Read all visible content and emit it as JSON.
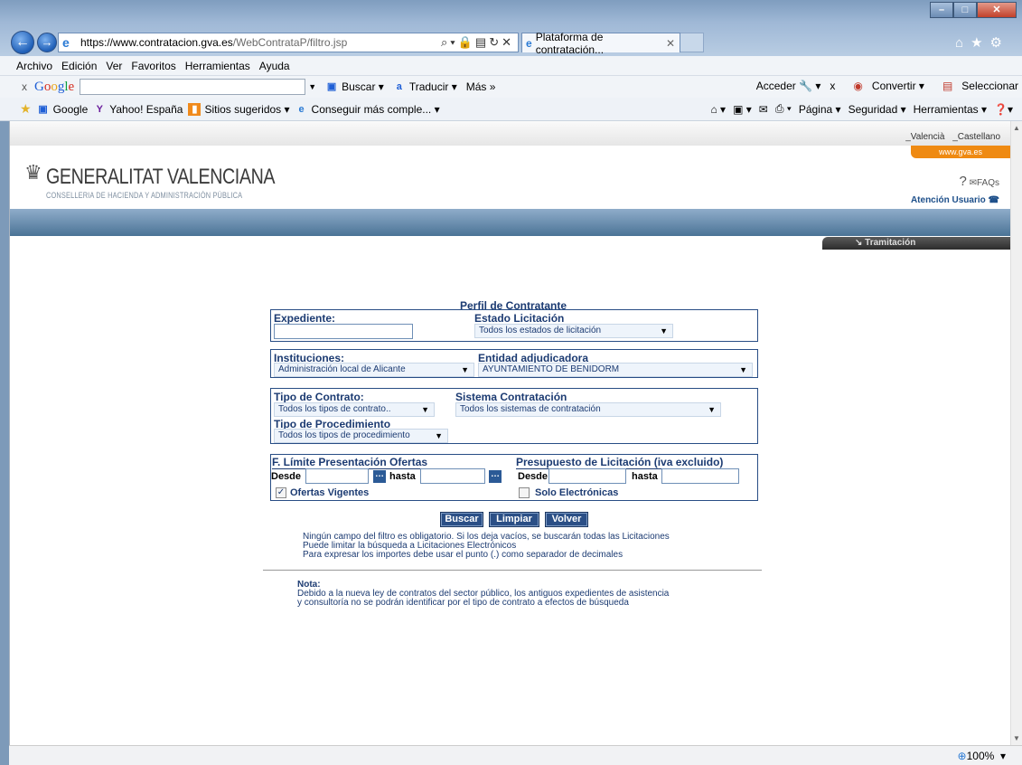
{
  "browser": {
    "url_host": "https://www.contratacion.gva.es",
    "url_path": "/WebContrataP/filtro.jsp",
    "tab_title": "Plataforma de contratación...",
    "menu": [
      "Archivo",
      "Edición",
      "Ver",
      "Favoritos",
      "Herramientas",
      "Ayuda"
    ],
    "google_bar": {
      "logo": "Google",
      "search_label": "Buscar",
      "translate_label": "Traducir",
      "more_label": "Más »",
      "signin_label": "Acceder",
      "convert_label": "Convertir",
      "select_label": "Seleccionar"
    },
    "favorites": {
      "items": [
        "Google",
        "Yahoo! España",
        "Sitios sugeridos ▾",
        "Conseguir más comple... ▾"
      ],
      "right": [
        "Página ▾",
        "Seguridad ▾",
        "Herramientas ▾"
      ]
    },
    "zoom": "100%"
  },
  "page_header": {
    "lang_valencia": "_Valencià",
    "lang_castellano": "_Castellano",
    "gva_link": "www.gva.es",
    "logo_title": "GENERALITAT VALENCIANA",
    "logo_subtitle": "CONSELLERIA DE HACIENDA Y ADMINISTRACIÓN PÚBLICA",
    "faqs": "FAQs",
    "atencion": "Atención Usuario",
    "tramitacion": "Tramitación"
  },
  "form": {
    "title": "Perfil de Contratante",
    "expediente_label": "Expediente:",
    "expediente_value": "",
    "estado_label": "Estado Licitación",
    "estado_value": "Todos los estados de licitación",
    "instituciones_label": "Instituciones:",
    "instituciones_value": "Administración local de Alicante",
    "entidad_label": "Entidad adjudicadora",
    "entidad_value": "AYUNTAMIENTO DE BENIDORM",
    "tipo_contrato_label": "Tipo de Contrato:",
    "tipo_contrato_value": "Todos los tipos de contrato..",
    "sistema_label": "Sistema Contratación",
    "sistema_value": "Todos los sistemas de contratación",
    "procedimiento_label": "Tipo de Procedimiento",
    "procedimiento_value": "Todos los tipos de procedimiento",
    "flimite_label": "F. Límite Presentación Ofertas",
    "presupuesto_label": "Presupuesto de Licitación (iva excluido)",
    "desde_label": "Desde",
    "hasta_label": "hasta",
    "ofertas_vigentes_label": "Ofertas Vigentes",
    "ofertas_vigentes_checked": true,
    "solo_electronicas_label": "Solo Electrónicas",
    "solo_electronicas_checked": false,
    "buscar": "Buscar",
    "limpiar": "Limpiar",
    "volver": "Volver",
    "help_lines": [
      "Ningún campo del filtro es obligatorio. Si los deja vacíos, se buscarán todas las Licitaciones",
      "Puede limitar la búsqueda a Licitaciones Electrónicos",
      "Para expresar los importes debe usar el punto (.) como separador de decimales"
    ],
    "nota_title": "Nota:",
    "nota_lines": [
      "Debido a la nueva ley de contratos del sector público, los antiguos expedientes de asistencia",
      "y consultoría no se podrán identificar por el tipo de contrato a efectos de búsqueda"
    ]
  }
}
